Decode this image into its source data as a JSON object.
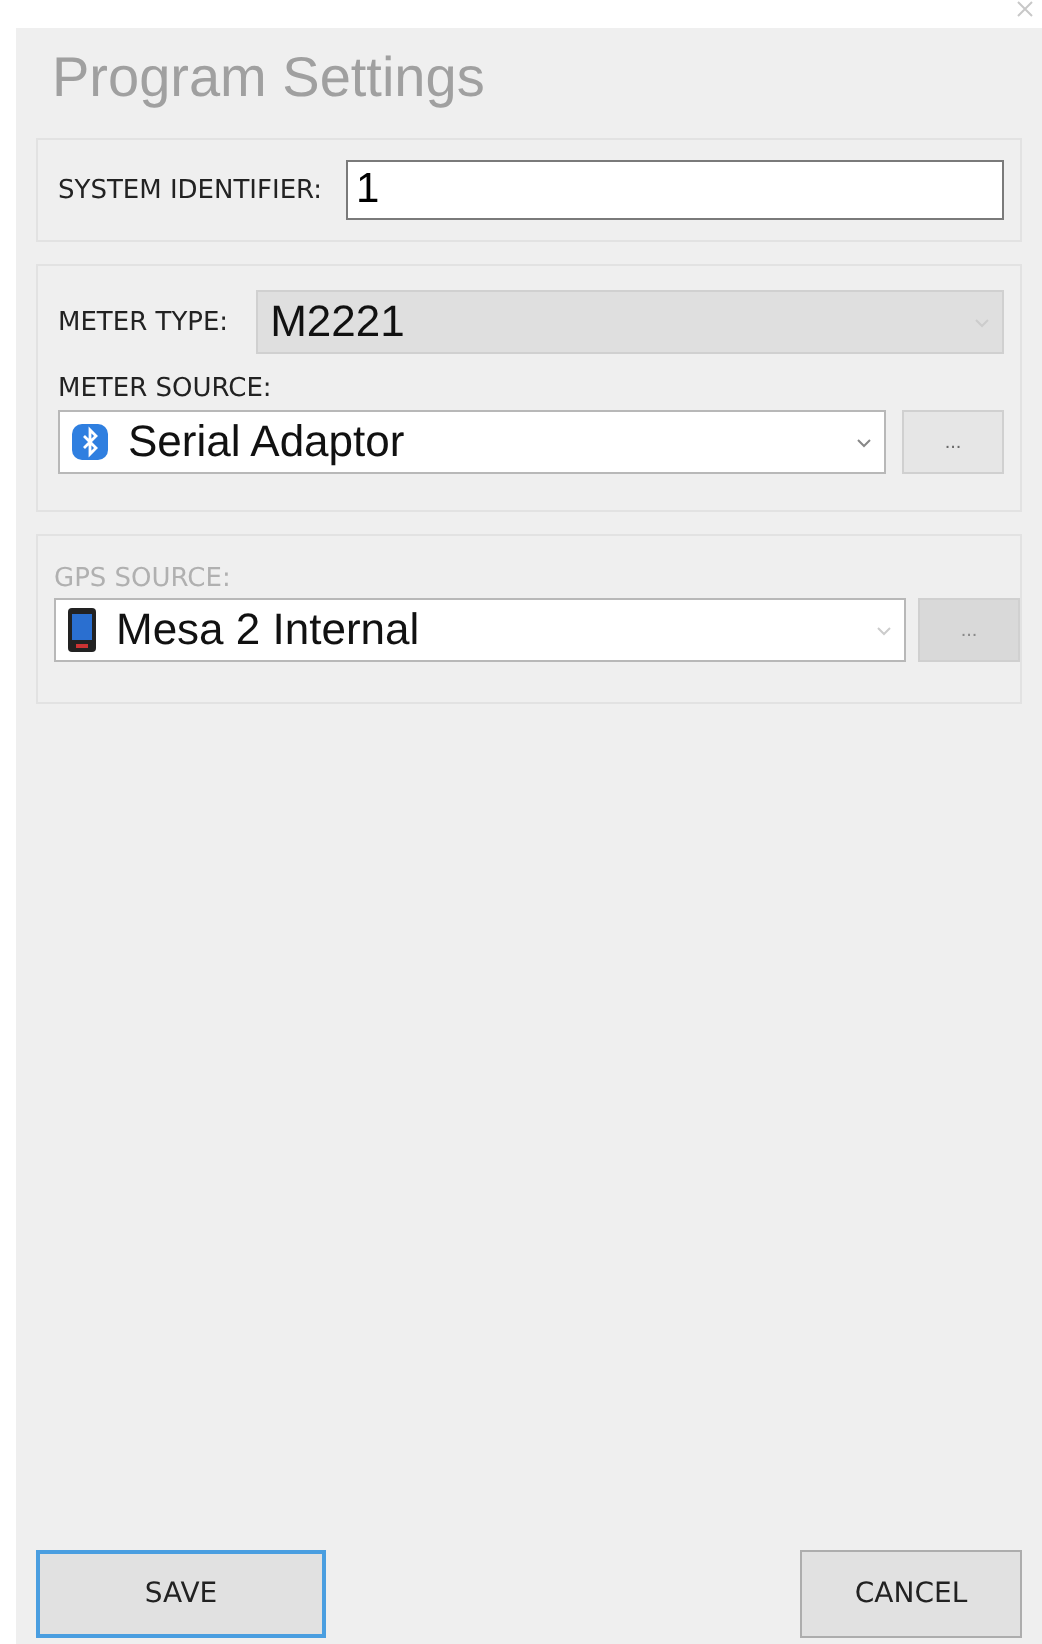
{
  "window": {
    "title": "Program Settings"
  },
  "system_identifier": {
    "label": "SYSTEM IDENTIFIER:",
    "value": "1"
  },
  "meter": {
    "type_label": "METER TYPE:",
    "type_value": "M2221",
    "type_disabled": true,
    "source_label": "METER SOURCE:",
    "source_value": "Serial Adaptor",
    "browse_label": "...",
    "disabled": false
  },
  "gps": {
    "source_label": "GPS SOURCE:",
    "source_value": "Mesa 2 Internal",
    "browse_label": "...",
    "disabled": true
  },
  "buttons": [
    {
      "label": "SAVE",
      "focused": true
    },
    {
      "label": "CANCEL",
      "focused": false
    }
  ]
}
